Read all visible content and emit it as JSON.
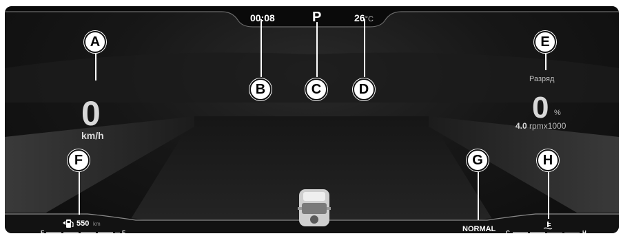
{
  "status": {
    "time": "00:08",
    "gear": "P",
    "temp_value": "26",
    "temp_unit": "°C"
  },
  "speed": {
    "value": "0",
    "unit": "km/h"
  },
  "power": {
    "label": "Разряд",
    "value": "0",
    "unit": "%",
    "rpm_value": "4.0",
    "rpm_unit": "rpmx1000"
  },
  "fuel": {
    "range_value": "550",
    "range_unit": "km",
    "empty_label": "E",
    "full_label": "F",
    "icon": "fuel-pump-icon"
  },
  "drive_mode": {
    "label": "NORMAL"
  },
  "coolant": {
    "cold_label": "C",
    "hot_label": "H",
    "icon": "coolant-temperature-icon"
  },
  "callouts": {
    "a": "A",
    "b": "B",
    "c": "C",
    "d": "D",
    "e": "E",
    "f": "F",
    "g": "G",
    "h": "H"
  }
}
